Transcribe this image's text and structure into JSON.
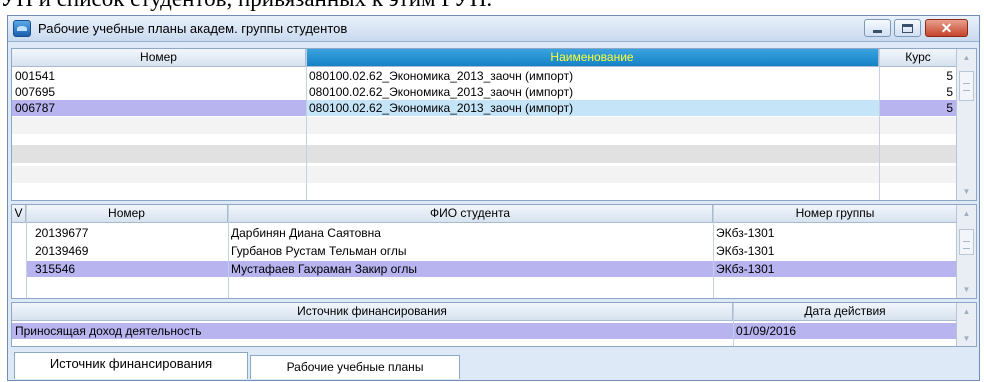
{
  "doc_fragment": "УП и список студентов, привязанных к этим РУП.",
  "window": {
    "title": "Рабочие учебные планы академ. группы студентов",
    "close_glyph": "✕"
  },
  "plans": {
    "columns": [
      "Номер",
      "Наименование",
      "Курс"
    ],
    "rows": [
      {
        "number": "001541",
        "name": "080100.02.62_Экономика_2013_заочн (импорт)",
        "course": "5"
      },
      {
        "number": "007695",
        "name": "080100.02.62_Экономика_2013_заочн (импорт)",
        "course": "5"
      },
      {
        "number": "006787",
        "name": "080100.02.62_Экономика_2013_заочн (импорт)",
        "course": "5"
      }
    ]
  },
  "students": {
    "columns": [
      "V",
      "Номер",
      "ФИО студента",
      "Номер группы"
    ],
    "rows": [
      {
        "number": "20139677",
        "name": "Дарбинян Диана Саятовна",
        "group": "ЭКбз-1301"
      },
      {
        "number": "20139469",
        "name": "Гурбанов Рустам Тельман оглы",
        "group": "ЭКбз-1301"
      },
      {
        "number": "315546",
        "name": "Мустафаев Гахраман Закир оглы",
        "group": "ЭКбз-1301"
      }
    ]
  },
  "funding": {
    "columns": [
      "Источник финансирования",
      "Дата действия"
    ],
    "rows": [
      {
        "source": "Приносящая доход деятельность",
        "date": "01/09/2016"
      }
    ]
  },
  "tabs": [
    {
      "label": "Источник финансирования"
    },
    {
      "label": "Рабочие учебные планы"
    }
  ],
  "colors": {
    "selected_row": "#b7b4f0",
    "selected_cell": "#c6e4f7",
    "active_header_text": "#ffff33"
  }
}
